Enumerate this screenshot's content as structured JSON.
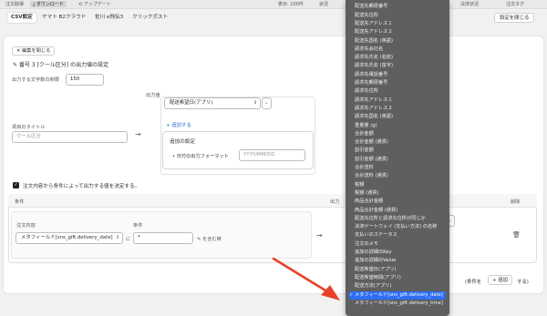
{
  "topbar": {
    "items": [
      "注文取得",
      "ダウンロード",
      "アップデート",
      "表示: 100件",
      "決済状況",
      "注文タグ"
    ],
    "right_label_partial": "状況"
  },
  "tabs": [
    "CSV設定",
    "ヤマト B2クラウド",
    "佐川 e飛伝3",
    "クリックポスト"
  ],
  "settings_close_label": "設定を閉じる",
  "editor": {
    "close_edit_label": "編集を閉じる",
    "heading": "番号 3 [クール区分] の出力値の設定",
    "char_limit_label": "出力する文字数の制限",
    "char_limit_value": "150",
    "output_value_label": "出力値",
    "item_title_label": "項目のタイトル",
    "item_title_placeholder": "クール区分",
    "output_select_value": "配送希望日(アプリ)",
    "add_link": "+ 追加する",
    "addon_title": "追加の設定",
    "date_format_label": "日付の出力フォーマット",
    "date_format_value": "YYYY/MM/DD"
  },
  "conditional": {
    "checkbox_label": "注文内容から条件によって出力する値を決定する。",
    "col_condition": "条件",
    "col_output_partial": "出力",
    "col_delete": "削除",
    "order_content_label": "注文内容",
    "condition_label": "条件",
    "field_select_value": "メタフィールド[sns_gift.delivery_date]",
    "ni_label": "に",
    "condition_input_value": "*",
    "contains_label": "を含む時",
    "footer_left": "(条件を",
    "add_button": "+ 追加",
    "footer_right": "する)"
  },
  "dropdown": {
    "items": [
      "配送先郵便番号",
      "配送先住所",
      "配送先アドレス１",
      "配送先アドレス２",
      "配送先国名 (英語)",
      "請求先会社名",
      "請求先氏名 (名前)",
      "請求先氏名 (苗字)",
      "請求先電話番号",
      "請求先郵便番号",
      "請求先住所",
      "請求先アドレス１",
      "請求先アドレス２",
      "請求先国名 (英語)",
      "重量量 (g)",
      "合計金額",
      "合計金額 (通貨)",
      "割引金額",
      "割引金額 (通貨)",
      "合計送料",
      "合計送料 (通貨)",
      "税額",
      "税額 (通貨)",
      "商品合計金額",
      "商品合計金額 (通貨)",
      "配送先住所と請求先住所が同じか",
      "決済ゲートウェイ (支払い方法) の名称",
      "支払いのステータス",
      "注文のメモ",
      "追加の詳細のKey",
      "追加の詳細のValue",
      "配送希望日(アプリ)",
      "配送希望時間(アプリ)",
      "配送方法(アプリ)",
      "メタフィールド[sns_gift.delivery_date]",
      "メタフィールド[sns_gift.delivery_time]"
    ],
    "selected_index": 34,
    "checkmark": "✓"
  },
  "colors": {
    "accent": "#2d6ef5",
    "dropdown_bg": "#5f5f5f",
    "annotation_arrow": "#e8402a"
  }
}
